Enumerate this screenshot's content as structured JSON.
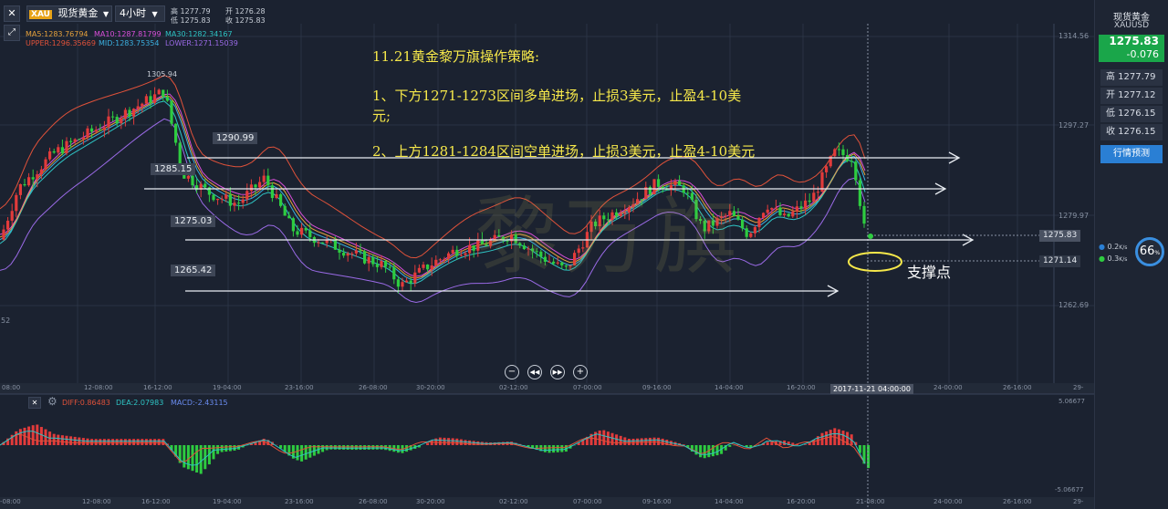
{
  "toolbar": {
    "close_label": "✕",
    "symbol_badge": "XAU",
    "symbol_name": "现货黄金",
    "period": "4小时",
    "high_label": "高 1277.79",
    "low_label": "低 1275.83",
    "open_label": "开 1276.28",
    "close_price_label": "收 1275.83"
  },
  "legend": {
    "ma5": "MA5:1283.76794",
    "ma10": "MA10:1287.81799",
    "ma30": "MA30:1282.34167",
    "upper": "UPPER:1296.35669",
    "mid": "MID:1283.75354",
    "lower": "LOWER:1271.15039"
  },
  "annotation": {
    "title": "11.21黄金黎万旗操作策略:",
    "line1a": "1、下方1271-1273区间多单进场，止损3美元，止盈4-10美",
    "line1b": "元;",
    "line2": "2、上方1281-1284区间空单进场，止损3美元，止盈4-10美元",
    "support": "支撑点",
    "watermark": "黎万旗"
  },
  "levels": {
    "peak": "1305.94",
    "l1290": "1290.99",
    "l1285": "1285.15",
    "l1275": "1275.03",
    "l1265": "1265.42"
  },
  "y_axis": {
    "t1": "1314.56",
    "t2": "1297.27",
    "t3": "1279.97",
    "t4": "1262.69",
    "current": "1275.83",
    "support": "1271.14",
    "left_stub": "52"
  },
  "x_axis": [
    "08:00",
    "12-08:00",
    "16-12:00",
    "19-04:00",
    "23-16:00",
    "26-08:00",
    "30-20:00",
    "02-12:00",
    "07-00:00",
    "09-16:00",
    "14-04:00",
    "16-20:00",
    "2017-11-21 04:00:00",
    "24-00:00",
    "26-16:00",
    "29-"
  ],
  "x_axis_lower": [
    "-08:00",
    "12-08:00",
    "16-12:00",
    "19-04:00",
    "23-16:00",
    "26-08:00",
    "30-20:00",
    "02-12:00",
    "07-00:00",
    "09-16:00",
    "14-04:00",
    "16-20:00",
    "21-08:00",
    "24-00:00",
    "26-16:00",
    "29-"
  ],
  "macd": {
    "diff": "DIFF:0.86483",
    "dea": "DEA:2.07983",
    "macd": "MACD:-2.43115",
    "y_top": "5.06677",
    "y_bot": "-5.06677"
  },
  "nav_icons": [
    "zoom-out-icon",
    "rewind-icon",
    "forward-icon",
    "zoom-in-icon"
  ],
  "side": {
    "title": "现货黄金",
    "code": "XAUUSD",
    "price": "1275.83",
    "change": "-0.076",
    "high": "高 1277.79",
    "open": "开 1277.12",
    "low": "低 1276.15",
    "close": "收 1276.15",
    "forecast_button": "行情预测",
    "gauge_value": "66",
    "gauge_unit": "%",
    "net_up": "0.2",
    "net_down": "0.3",
    "net_unit": "K/s"
  },
  "colors": {
    "background": "#1b2230",
    "up": "#e23b3b",
    "down": "#2ecc40",
    "annotation": "#f6e84a",
    "price_badge": "#1aa64a",
    "forecast": "#2a7fd4"
  }
}
